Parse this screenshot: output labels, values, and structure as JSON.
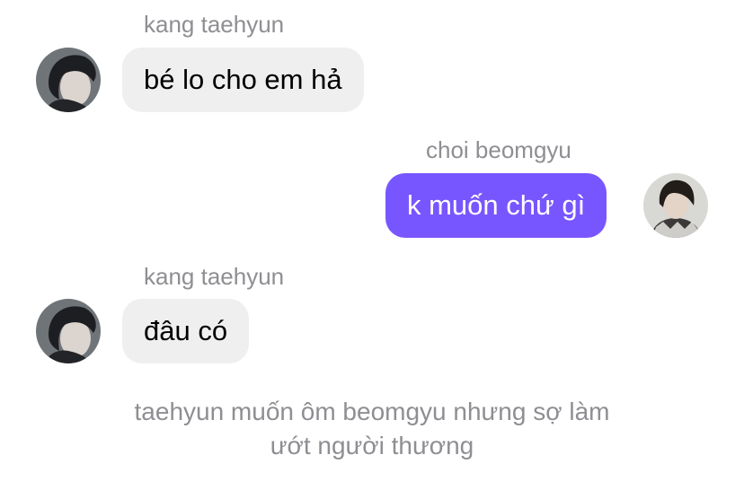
{
  "messages": [
    {
      "sender": "kang taehyun",
      "text": "bé lo cho em hả",
      "direction": "incoming",
      "avatar_icon": "taehyun-avatar"
    },
    {
      "sender": "choi beomgyu",
      "text": "k muốn chứ gì",
      "direction": "outgoing",
      "avatar_icon": "beomgyu-avatar"
    },
    {
      "sender": "kang taehyun",
      "text": "đâu có",
      "direction": "incoming",
      "avatar_icon": "taehyun-avatar"
    }
  ],
  "narration": {
    "line1": "taehyun muốn ôm beomgyu nhưng sợ làm",
    "line2": "ướt người thương"
  },
  "colors": {
    "incoming_bubble": "#efefef",
    "outgoing_bubble": "#7856ff",
    "secondary_text": "#8e8e93"
  }
}
